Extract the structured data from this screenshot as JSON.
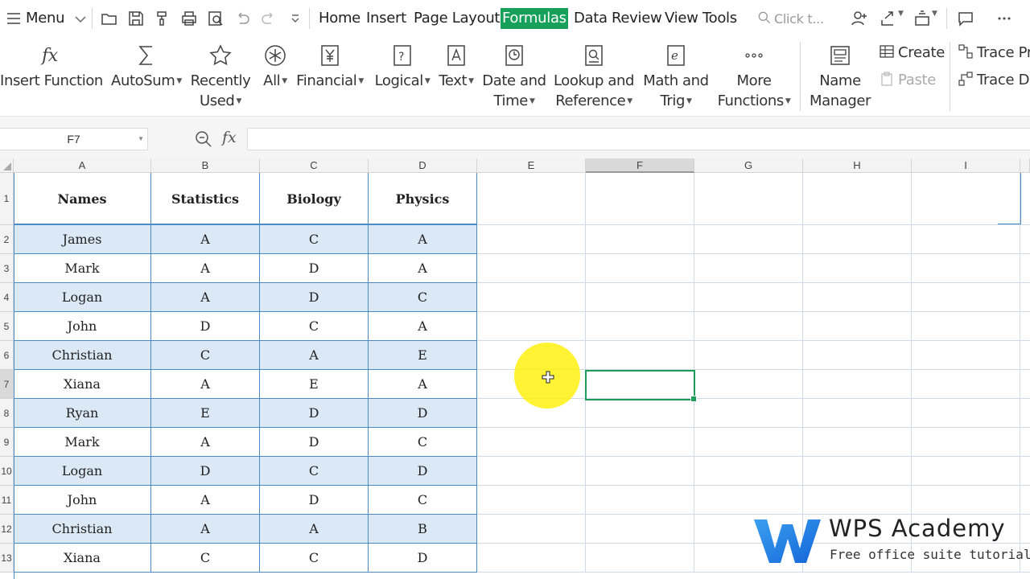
{
  "menu": {
    "label": "Menu",
    "tabs": [
      "Home",
      "Insert",
      "Page Layout",
      "Formulas",
      "Data",
      "Review",
      "View",
      "Tools"
    ],
    "active_tab": "Formulas",
    "search_placeholder": "Click t...",
    "accent": "#17a05a"
  },
  "ribbon": {
    "insert_function": "Insert Function",
    "autosum": "AutoSum",
    "recently_used": [
      "Recently",
      "Used"
    ],
    "all": "All",
    "financial": "Financial",
    "logical": "Logical",
    "text": "Text",
    "date_time": [
      "Date and",
      "Time"
    ],
    "lookup": [
      "Lookup and",
      "Reference"
    ],
    "math": [
      "Math and",
      "Trig"
    ],
    "more": [
      "More",
      "Functions"
    ],
    "name_manager": [
      "Name",
      "Manager"
    ],
    "create": "Create",
    "paste": "Paste",
    "trace_precedents": "Trace Pr",
    "trace_dependents": "Trace D"
  },
  "formula_bar": {
    "name_box": "F7",
    "fx": "fx",
    "value": ""
  },
  "columns": [
    "A",
    "B",
    "C",
    "D",
    "E",
    "F",
    "G",
    "H",
    "I"
  ],
  "selected_column": "F",
  "rows": [
    "1",
    "2",
    "3",
    "4",
    "5",
    "6",
    "7",
    "8",
    "9",
    "10",
    "11",
    "12",
    "13"
  ],
  "selected_row": "7",
  "table": {
    "headers": [
      "Names",
      "Statistics",
      "Biology",
      "Physics"
    ],
    "data": [
      [
        "James",
        "A",
        "C",
        "A"
      ],
      [
        "Mark",
        "A",
        "D",
        "A"
      ],
      [
        "Logan",
        "A",
        "D",
        "C"
      ],
      [
        "John",
        "D",
        "C",
        "A"
      ],
      [
        "Christian",
        "C",
        "A",
        "E"
      ],
      [
        "Xiana",
        "A",
        "E",
        "A"
      ],
      [
        "Ryan",
        "E",
        "D",
        "D"
      ],
      [
        "Mark",
        "A",
        "D",
        "C"
      ],
      [
        "Logan",
        "D",
        "C",
        "D"
      ],
      [
        "John",
        "A",
        "D",
        "C"
      ],
      [
        "Christian",
        "A",
        "A",
        "B"
      ],
      [
        "Xiana",
        "C",
        "C",
        "D"
      ]
    ]
  },
  "watermark": {
    "title": "WPS Academy",
    "subtitle": "Free office suite tutorials"
  }
}
